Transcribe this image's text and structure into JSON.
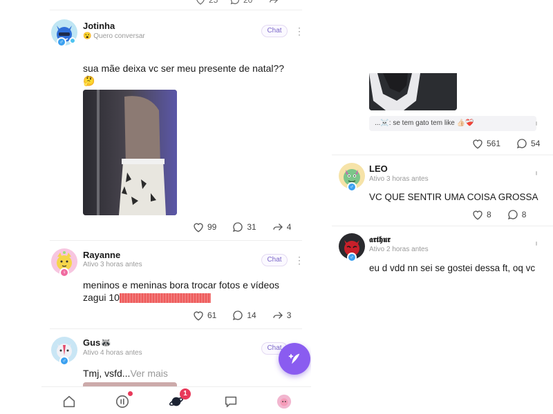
{
  "left_panel": {
    "top_counts": {
      "likes": "25",
      "comments": "20"
    },
    "posts": [
      {
        "username": "Jotinha",
        "status_emoji": "😮",
        "status": "Quero conversar",
        "chat_label": "Chat",
        "text_line1": "sua mãe deixa vc ser meu presente de natal??",
        "text_emoji": "🤔",
        "likes": "99",
        "comments": "31",
        "shares": "4"
      },
      {
        "username": "Rayanne",
        "status": "Ativo 3 horas antes",
        "chat_label": "Chat",
        "text_line1": "meninos e meninas bora trocar fotos e vídeos",
        "text_line2": "zagui 10",
        "likes": "61",
        "comments": "14",
        "shares": "3"
      },
      {
        "username": "Gus",
        "username_emoji": "🦝",
        "status": "Ativo 4 horas antes",
        "chat_label": "Chat",
        "text": "Tmj, vsfd...",
        "more_label": "Ver mais"
      }
    ],
    "nav": {
      "items": [
        "home-icon",
        "voice-icon",
        "planet-icon",
        "chat-icon",
        "profile-avatar"
      ],
      "planet_badge": "1"
    }
  },
  "right_panel": {
    "caption": "...☠️: se tem gato tem like 👍🏻❤️‍🩹",
    "caption_likes": "561",
    "caption_comments": "54",
    "posts": [
      {
        "username": "LEO",
        "status": "Ativo 3 horas antes",
        "text": "VC QUE SENTIR UMA COISA  GROSSA",
        "likes": "8",
        "comments": "8"
      },
      {
        "username": "𝖆𝖗𝖙𝖍𝖚𝖗",
        "status": "Ativo 2 horas antes",
        "text": "eu d vdd nn sei se gostei dessa ft, oq vc"
      }
    ]
  },
  "colors": {
    "accent": "#8a5cf0",
    "chat_text": "#7a66c8",
    "badge": "#e83a5a",
    "gender_male": "#3aa0f0",
    "redaction": "#ee5b5b"
  }
}
